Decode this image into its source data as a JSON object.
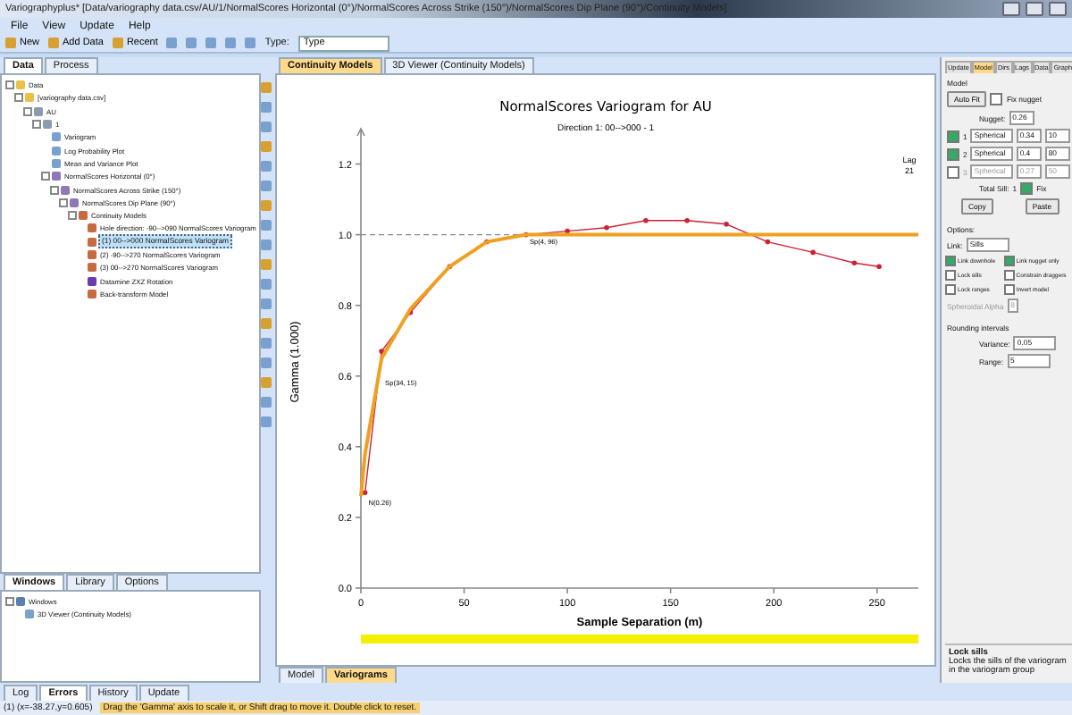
{
  "window": {
    "title": "Variographyplus* [Data/variography data.csv/AU/1/NormalScores Horizontal (0°)/NormalScores Across Strike (150°)/NormalScores Dip Plane (90°)/Continuity Models]"
  },
  "menu": [
    "File",
    "View",
    "Update",
    "Help"
  ],
  "toolbar": {
    "buttons": [
      "New",
      "Add Data",
      "Recent"
    ],
    "type_label": "Type:",
    "type_value": "Type"
  },
  "left_tabs": [
    {
      "label": "Data",
      "selected": true
    },
    {
      "label": "Process",
      "selected": false
    }
  ],
  "data_tree": [
    {
      "label": "Data",
      "kind": "folder",
      "selected": false,
      "expanded": true,
      "children": [
        {
          "label": "[variography data.csv]",
          "kind": "folder",
          "selected": false,
          "expanded": true,
          "children": [
            {
              "label": "AU",
              "kind": "table",
              "selected": false,
              "expanded": true,
              "children": [
                {
                  "label": "1",
                  "kind": "table",
                  "selected": false,
                  "expanded": true,
                  "children": [
                    {
                      "label": "Variogram",
                      "kind": "chart",
                      "selected": false
                    },
                    {
                      "label": "Log Probability Plot",
                      "kind": "chart",
                      "selected": false
                    },
                    {
                      "label": "Mean and Variance Plot",
                      "kind": "chart",
                      "selected": false
                    },
                    {
                      "label": "NormalScores Horizontal (0°)",
                      "kind": "axes",
                      "selected": false,
                      "expanded": true,
                      "children": [
                        {
                          "label": "NormalScores Across Strike (150°)",
                          "kind": "axes",
                          "selected": false,
                          "expanded": true,
                          "children": [
                            {
                              "label": "NormalScores Dip Plane (90°)",
                              "kind": "axes",
                              "selected": false,
                              "expanded": true,
                              "children": [
                                {
                                  "label": "Continuity Models",
                                  "kind": "model",
                                  "selected": false,
                                  "expanded": true,
                                  "children": [
                                    {
                                      "label": "Hole direction: -90-->090 NormalScores Variogram",
                                      "kind": "model",
                                      "selected": false
                                    },
                                    {
                                      "label": "(1) 00-->000 NormalScores Variogram",
                                      "kind": "model",
                                      "selected": true
                                    },
                                    {
                                      "label": "(2) -90-->270 NormalScores Variogram",
                                      "kind": "model",
                                      "selected": false
                                    },
                                    {
                                      "label": "(3) 00-->270 NormalScores Variogram",
                                      "kind": "model",
                                      "selected": false
                                    },
                                    {
                                      "label": "Datamine ZXZ Rotation",
                                      "kind": "rotation",
                                      "selected": false
                                    },
                                    {
                                      "label": "Back-transform Model",
                                      "kind": "model",
                                      "selected": false
                                    }
                                  ]
                                }
                              ]
                            }
                          ]
                        }
                      ]
                    }
                  ]
                }
              ]
            }
          ]
        }
      ]
    }
  ],
  "lower_tabs": [
    {
      "label": "Windows",
      "selected": true
    },
    {
      "label": "Library",
      "selected": false
    },
    {
      "label": "Options",
      "selected": false
    }
  ],
  "windows_tree": [
    {
      "label": "Windows",
      "kind": "window",
      "selected": false,
      "expanded": true,
      "children": [
        {
          "label": "3D Viewer (Continuity Models)",
          "kind": "chart",
          "selected": false
        }
      ]
    }
  ],
  "doc_tabs": [
    {
      "label": "Continuity Models",
      "selected": true
    },
    {
      "label": "3D Viewer (Continuity Models)",
      "selected": false
    }
  ],
  "chart": {
    "subtitle": "Direction 1: 00-->000 - 1",
    "lag_label": "Lag",
    "lag_value": "21",
    "chart_data": {
      "type": "line",
      "title": "NormalScores  Variogram for AU",
      "xlabel": "Sample Separation (m)",
      "ylabel": "Gamma (1.000)",
      "x": [
        0,
        2,
        10,
        24,
        43,
        61,
        80,
        100,
        119,
        138,
        158,
        177,
        197,
        219,
        239,
        251,
        270
      ],
      "series": [
        {
          "color": "#cc2233",
          "values": [
            null,
            0.27,
            0.67,
            0.78,
            0.91,
            0.98,
            1.0,
            1.01,
            1.02,
            1.04,
            1.04,
            1.03,
            0.98,
            0.95,
            0.92,
            0.91,
            null
          ]
        },
        {
          "color": "#f0a020",
          "values": [
            0.26,
            0.38,
            0.65,
            0.79,
            0.91,
            0.98,
            1.0,
            1.0,
            1.0,
            1.0,
            1.0,
            1.0,
            1.0,
            1.0,
            1.0,
            1.0,
            1.0
          ]
        }
      ],
      "xlim": [
        0,
        270
      ],
      "ylim": [
        0,
        1.3
      ],
      "xticks": [
        0,
        50,
        100,
        150,
        200,
        250
      ],
      "yticks": [
        {
          "value": 0,
          "label": "0.0"
        },
        {
          "value": 0.2,
          "label": "0.2"
        },
        {
          "value": 0.4,
          "label": "0.4"
        },
        {
          "value": 0.6,
          "label": "0.6"
        },
        {
          "value": 0.8,
          "label": "0.8"
        },
        {
          "value": 1.0,
          "label": "1.0"
        },
        {
          "value": 1.2,
          "label": "1.2"
        }
      ],
      "annotations": [
        {
          "text": "Sp(4, 96)",
          "x": 80,
          "y": 1.0
        },
        {
          "text": "Sp(34, 15)",
          "x": 10,
          "y": 0.6
        },
        {
          "text": "N(0.26)",
          "x": 2,
          "y": 0.26
        }
      ]
    }
  },
  "view_tabs": [
    {
      "label": "Model",
      "selected": false
    },
    {
      "label": "Variograms",
      "selected": true
    }
  ],
  "side_panel": {
    "tabs": [
      {
        "label": "Update",
        "selected": false
      },
      {
        "label": "Model",
        "selected": true
      },
      {
        "label": "Dirs",
        "selected": false
      },
      {
        "label": "Lags",
        "selected": false
      },
      {
        "label": "Data",
        "selected": false
      },
      {
        "label": "Graph",
        "selected": false
      }
    ],
    "model": {
      "heading": "Model",
      "auto_fit": "Auto Fit",
      "fix_nugget": {
        "label": "Fix nugget",
        "checked": false
      },
      "nugget": {
        "label": "Nugget:",
        "value": "0.26"
      },
      "structures": [
        {
          "index": "1",
          "checked": true,
          "type": "Spherical",
          "sill": "0.34",
          "range": "10"
        },
        {
          "index": "2",
          "checked": true,
          "type": "Spherical",
          "sill": "0.4",
          "range": "80"
        },
        {
          "index": "3",
          "checked": false,
          "type": "Spherical",
          "sill": "0.27",
          "range": "50"
        }
      ],
      "total_sill": {
        "label": "Total Sill:",
        "value": "1"
      },
      "fix": {
        "label": "Fix",
        "checked": true
      },
      "buttons": [
        "Copy",
        "Paste"
      ]
    },
    "options": {
      "heading": "Options:",
      "link": {
        "label": "Link:",
        "value": "Sills"
      },
      "checks": [
        {
          "label": "Link downhole",
          "checked": true
        },
        {
          "label": "Link nugget only",
          "checked": true
        },
        {
          "label": "Lock sills",
          "checked": false
        },
        {
          "label": "Constrain draggers",
          "checked": false
        },
        {
          "label": "Lock ranges",
          "checked": false
        },
        {
          "label": "Invert model",
          "checked": false
        }
      ],
      "spheroidal": {
        "label": "Spheroidal Alpha",
        "value": "8",
        "disabled": true
      }
    },
    "rounding": {
      "heading": "Rounding intervals",
      "fields": [
        {
          "label": "Variance:",
          "value": "0.05"
        },
        {
          "label": "Range:",
          "value": "5"
        }
      ]
    },
    "help": {
      "title": "Lock sills",
      "text": "Locks the sills of the variogram in the variogram group"
    }
  },
  "bottom_tabs": [
    {
      "label": "Log",
      "selected": false
    },
    {
      "label": "Errors",
      "selected": true
    },
    {
      "label": "History",
      "selected": false
    },
    {
      "label": "Update",
      "selected": false
    }
  ],
  "status_bar": {
    "coords": "(1)  (x=-38.27,y=0.605)",
    "message": "Drag the 'Gamma' axis to scale it, or Shift drag to move it. Double click to reset."
  }
}
